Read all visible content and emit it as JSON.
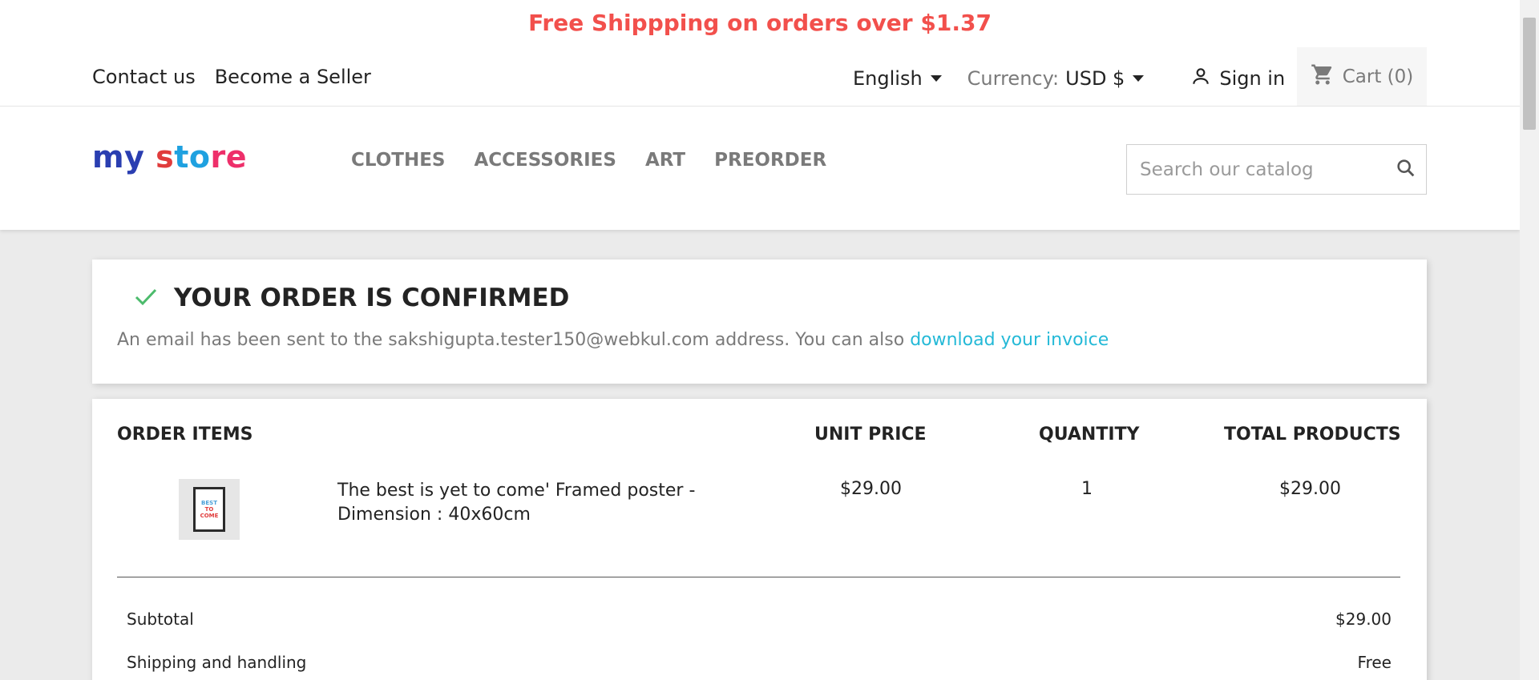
{
  "promo": {
    "text": "Free Shippping on orders over $1.37",
    "color": "#f2504c"
  },
  "nav": {
    "left": [
      "Contact us",
      "Become a Seller"
    ],
    "language": "English",
    "currency_label": "Currency:",
    "currency_value": "USD $",
    "signin": "Sign in",
    "cart": "Cart (0)"
  },
  "logo": {
    "part1": "my ",
    "part2": "s",
    "part3": "to",
    "part4": "re"
  },
  "categories": [
    "CLOTHES",
    "ACCESSORIES",
    "ART",
    "PREORDER"
  ],
  "search": {
    "placeholder": "Search our catalog"
  },
  "confirmation": {
    "title": "YOUR ORDER IS CONFIRMED",
    "message": "An email has been sent to the sakshigupta.tester150@webkul.com address. You can also ",
    "link": "download your invoice",
    "link_color": "#24b9d7",
    "check_color": "#4cbb6c"
  },
  "order_items": {
    "headers": {
      "item": "ORDER ITEMS",
      "unit_price": "UNIT PRICE",
      "quantity": "QUANTITY",
      "total": "TOTAL PRODUCTS"
    },
    "rows": [
      {
        "name_line1": "The best is yet to come' Framed poster -",
        "name_line2": "Dimension : 40x60cm",
        "unit_price": "$29.00",
        "quantity": "1",
        "total": "$29.00"
      }
    ],
    "summary": [
      {
        "label": "Subtotal",
        "value": "$29.00"
      },
      {
        "label": "Shipping and handling",
        "value": "Free"
      }
    ]
  }
}
